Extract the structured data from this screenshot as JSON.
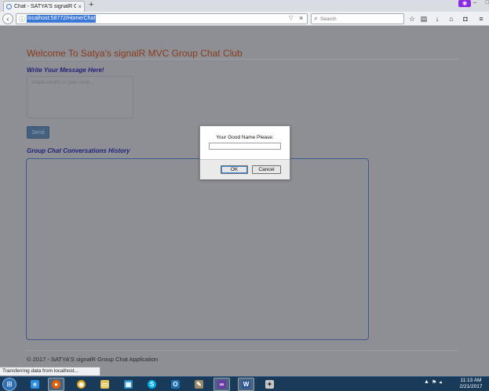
{
  "browser": {
    "tab_title": "Chat - SATYA'S signalR Gr...",
    "tab_close": "×",
    "new_tab": "+",
    "url": "localhost:58772/Home/Chat",
    "search_placeholder": "Search"
  },
  "page": {
    "title": "Welcome To Satya's signalR MVC Group Chat Club",
    "message_label": "Write Your Message Here!",
    "message_placeholder": "Share what's in your mind...",
    "send_label": "Send",
    "history_label": "Group Chat Conversations History",
    "footer": "© 2017 - SATYA'S signalR Group Chat Application"
  },
  "dialog": {
    "message": "Your Good Name Please:",
    "input_value": "",
    "ok_label": "OK",
    "cancel_label": "Cancel"
  },
  "status_bar": {
    "text": "Transferring data from localhost..."
  },
  "taskbar": {
    "time": "11:13 AM",
    "date": "2/21/2017",
    "apps": [
      "internet-explorer",
      "firefox",
      "chrome",
      "file-explorer",
      "skype",
      "outlook",
      "tools",
      "visual-studio",
      "word",
      "paint"
    ]
  },
  "colors": {
    "overlay_bg": "#8e8f95",
    "page_title": "#8a3a1c",
    "section_label": "#23237a",
    "send_button": "#44607f",
    "history_border": "#3d5a8a",
    "url_highlight": "#3b78d8"
  }
}
